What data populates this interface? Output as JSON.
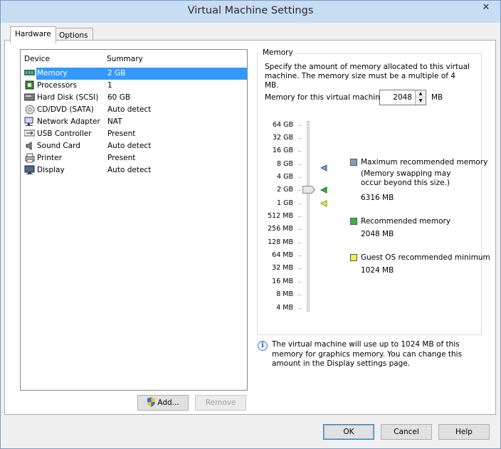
{
  "window": {
    "title": "Virtual Machine Settings",
    "close_glyph": "✕"
  },
  "tabs": [
    {
      "label": "Hardware"
    },
    {
      "label": "Options"
    }
  ],
  "device_list": {
    "col_device": "Device",
    "col_summary": "Summary",
    "rows": [
      {
        "name": "Memory",
        "summary": "2 GB",
        "icon": "memory-icon",
        "selected": true
      },
      {
        "name": "Processors",
        "summary": "1",
        "icon": "processor-icon"
      },
      {
        "name": "Hard Disk (SCSI)",
        "summary": "60 GB",
        "icon": "hard-disk-icon"
      },
      {
        "name": "CD/DVD (SATA)",
        "summary": "Auto detect",
        "icon": "cd-dvd-icon"
      },
      {
        "name": "Network Adapter",
        "summary": "NAT",
        "icon": "network-adapter-icon"
      },
      {
        "name": "USB Controller",
        "summary": "Present",
        "icon": "usb-icon"
      },
      {
        "name": "Sound Card",
        "summary": "Auto detect",
        "icon": "sound-card-icon"
      },
      {
        "name": "Printer",
        "summary": "Present",
        "icon": "printer-icon"
      },
      {
        "name": "Display",
        "summary": "Auto detect",
        "icon": "display-icon"
      }
    ]
  },
  "list_buttons": {
    "add": "Add...",
    "remove": "Remove"
  },
  "memory": {
    "group_label": "Memory",
    "description": "Specify the amount of memory allocated to this virtual machine. The memory size must be a multiple of 4 MB.",
    "field_label": "Memory for this virtual machine:",
    "value": "2048",
    "unit": "MB",
    "scale": [
      "64 GB",
      "32 GB",
      "16 GB",
      "8 GB",
      "4 GB",
      "2 GB",
      "1 GB",
      "512 MB",
      "256 MB",
      "128 MB",
      "64 MB",
      "32 MB",
      "16 MB",
      "8 MB",
      "4 MB"
    ],
    "legend": {
      "max_label": "Maximum recommended memory",
      "max_note": "(Memory swapping may occur beyond this size.)",
      "max_value": "6316 MB",
      "rec_label": "Recommended memory",
      "rec_value": "2048 MB",
      "min_label": "Guest OS recommended minimum",
      "min_value": "1024 MB"
    },
    "colors": {
      "max": "#7f9fc8",
      "rec": "#3cb33c",
      "min": "#f0f04a"
    },
    "info": "The virtual machine will use up to 1024 MB of this memory for graphics memory. You can change this amount in the Display settings page."
  },
  "footer": {
    "ok": "OK",
    "cancel": "Cancel",
    "help": "Help"
  }
}
